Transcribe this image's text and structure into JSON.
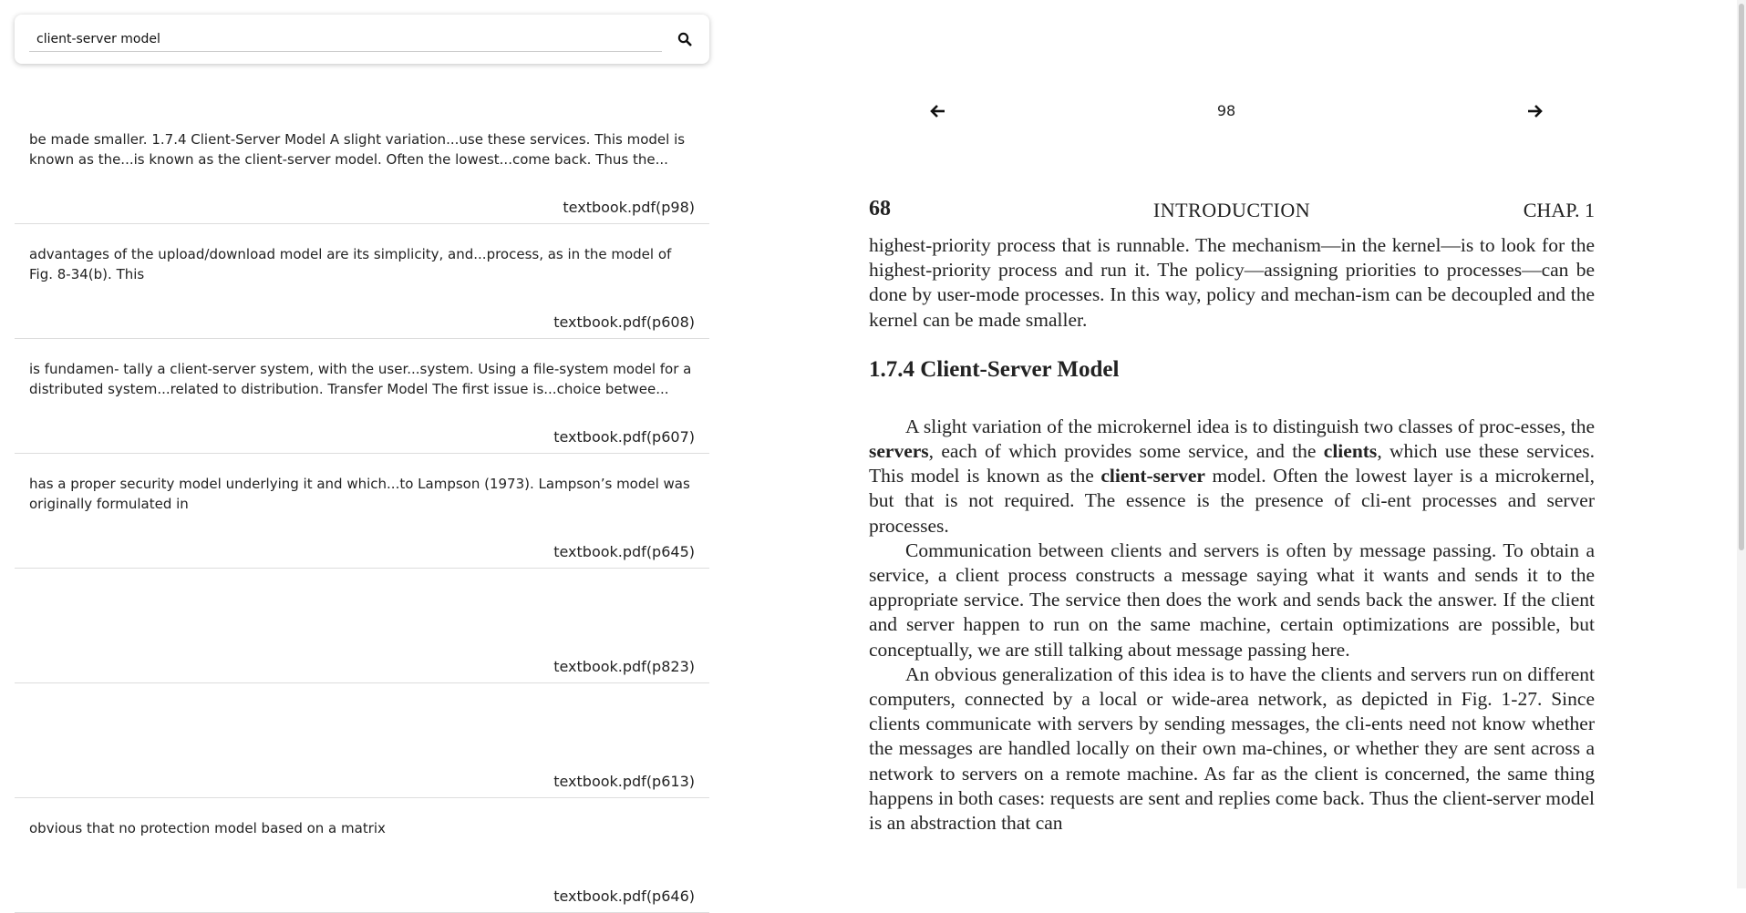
{
  "search": {
    "value": "client-server model",
    "button_icon": "search-icon"
  },
  "results": [
    {
      "snippet": "be made smaller. 1.7.4 Client-Server Model A slight variation...use these services. This model is known as the...is known as the client-server model. Often the lowest...come back. Thus the...",
      "source": "textbook.pdf(p98)"
    },
    {
      "snippet": "advantages of the upload/download model are its simplicity, and...process, as in the model of Fig. 8-34(b). This",
      "source": "textbook.pdf(p608)"
    },
    {
      "snippet": "is fundamen- tally a client-server system, with the user...system. Using a file-system model for a distributed system...related to distribution. Transfer Model The first issue is...choice betwee...",
      "source": "textbook.pdf(p607)"
    },
    {
      "snippet": "has a proper security model underlying it and which...to Lampson (1973). Lampson’s model was originally formulated in",
      "source": "textbook.pdf(p645)"
    },
    {
      "snippet": "",
      "source": "textbook.pdf(p823)"
    },
    {
      "snippet": "",
      "source": "textbook.pdf(p613)"
    },
    {
      "snippet": "obvious that no protection model based on a matrix",
      "source": "textbook.pdf(p646)"
    }
  ],
  "viewer": {
    "page_number": "98",
    "prev_icon": "arrow-left-icon",
    "next_icon": "arrow-right-icon",
    "page": {
      "page_label": "68",
      "section": "INTRODUCTION",
      "chapter": "CHAP. 1",
      "para1": "highest-priority process that is runnable. The mechanism—in the kernel—is to look for the highest-priority process and run it. The policy—assigning priorities to processes—can be done by user-mode processes. In this way, policy and mechan-ism can be decoupled and the kernel can be made smaller.",
      "heading": "1.7.4  Client-Server Model",
      "para2_a": "A slight variation of the microkernel idea is to distinguish two classes of proc-esses, the ",
      "para2_b": "servers",
      "para2_c": ", each of which provides some service, and the ",
      "para2_d": "clients",
      "para2_e": ", which use these services. This model is known as the ",
      "para2_f": "client-server",
      "para2_g": " model. Often the lowest layer is a microkernel, but that is not required. The essence is the presence of cli-ent processes and server processes.",
      "para3": "Communication between clients and servers is often by message passing. To obtain a service, a client process constructs a message saying what it wants and sends it to the appropriate service. The service then does the work and sends back the answer. If the client and server happen to run on the same machine, certain optimizations are possible, but conceptually, we are still talking about message passing here.",
      "para4": "An obvious generalization of this idea is to have the clients and servers run on different computers, connected by a local or wide-area network, as depicted in Fig. 1-27. Since clients communicate with servers by sending messages, the cli-ents need not know whether the messages are handled locally on their own ma-chines, or whether they are sent across a network to servers on a remote machine. As far as the client is concerned, the same thing happens in both cases: requests are sent and replies come back. Thus the client-server model is an abstraction that can"
    }
  }
}
